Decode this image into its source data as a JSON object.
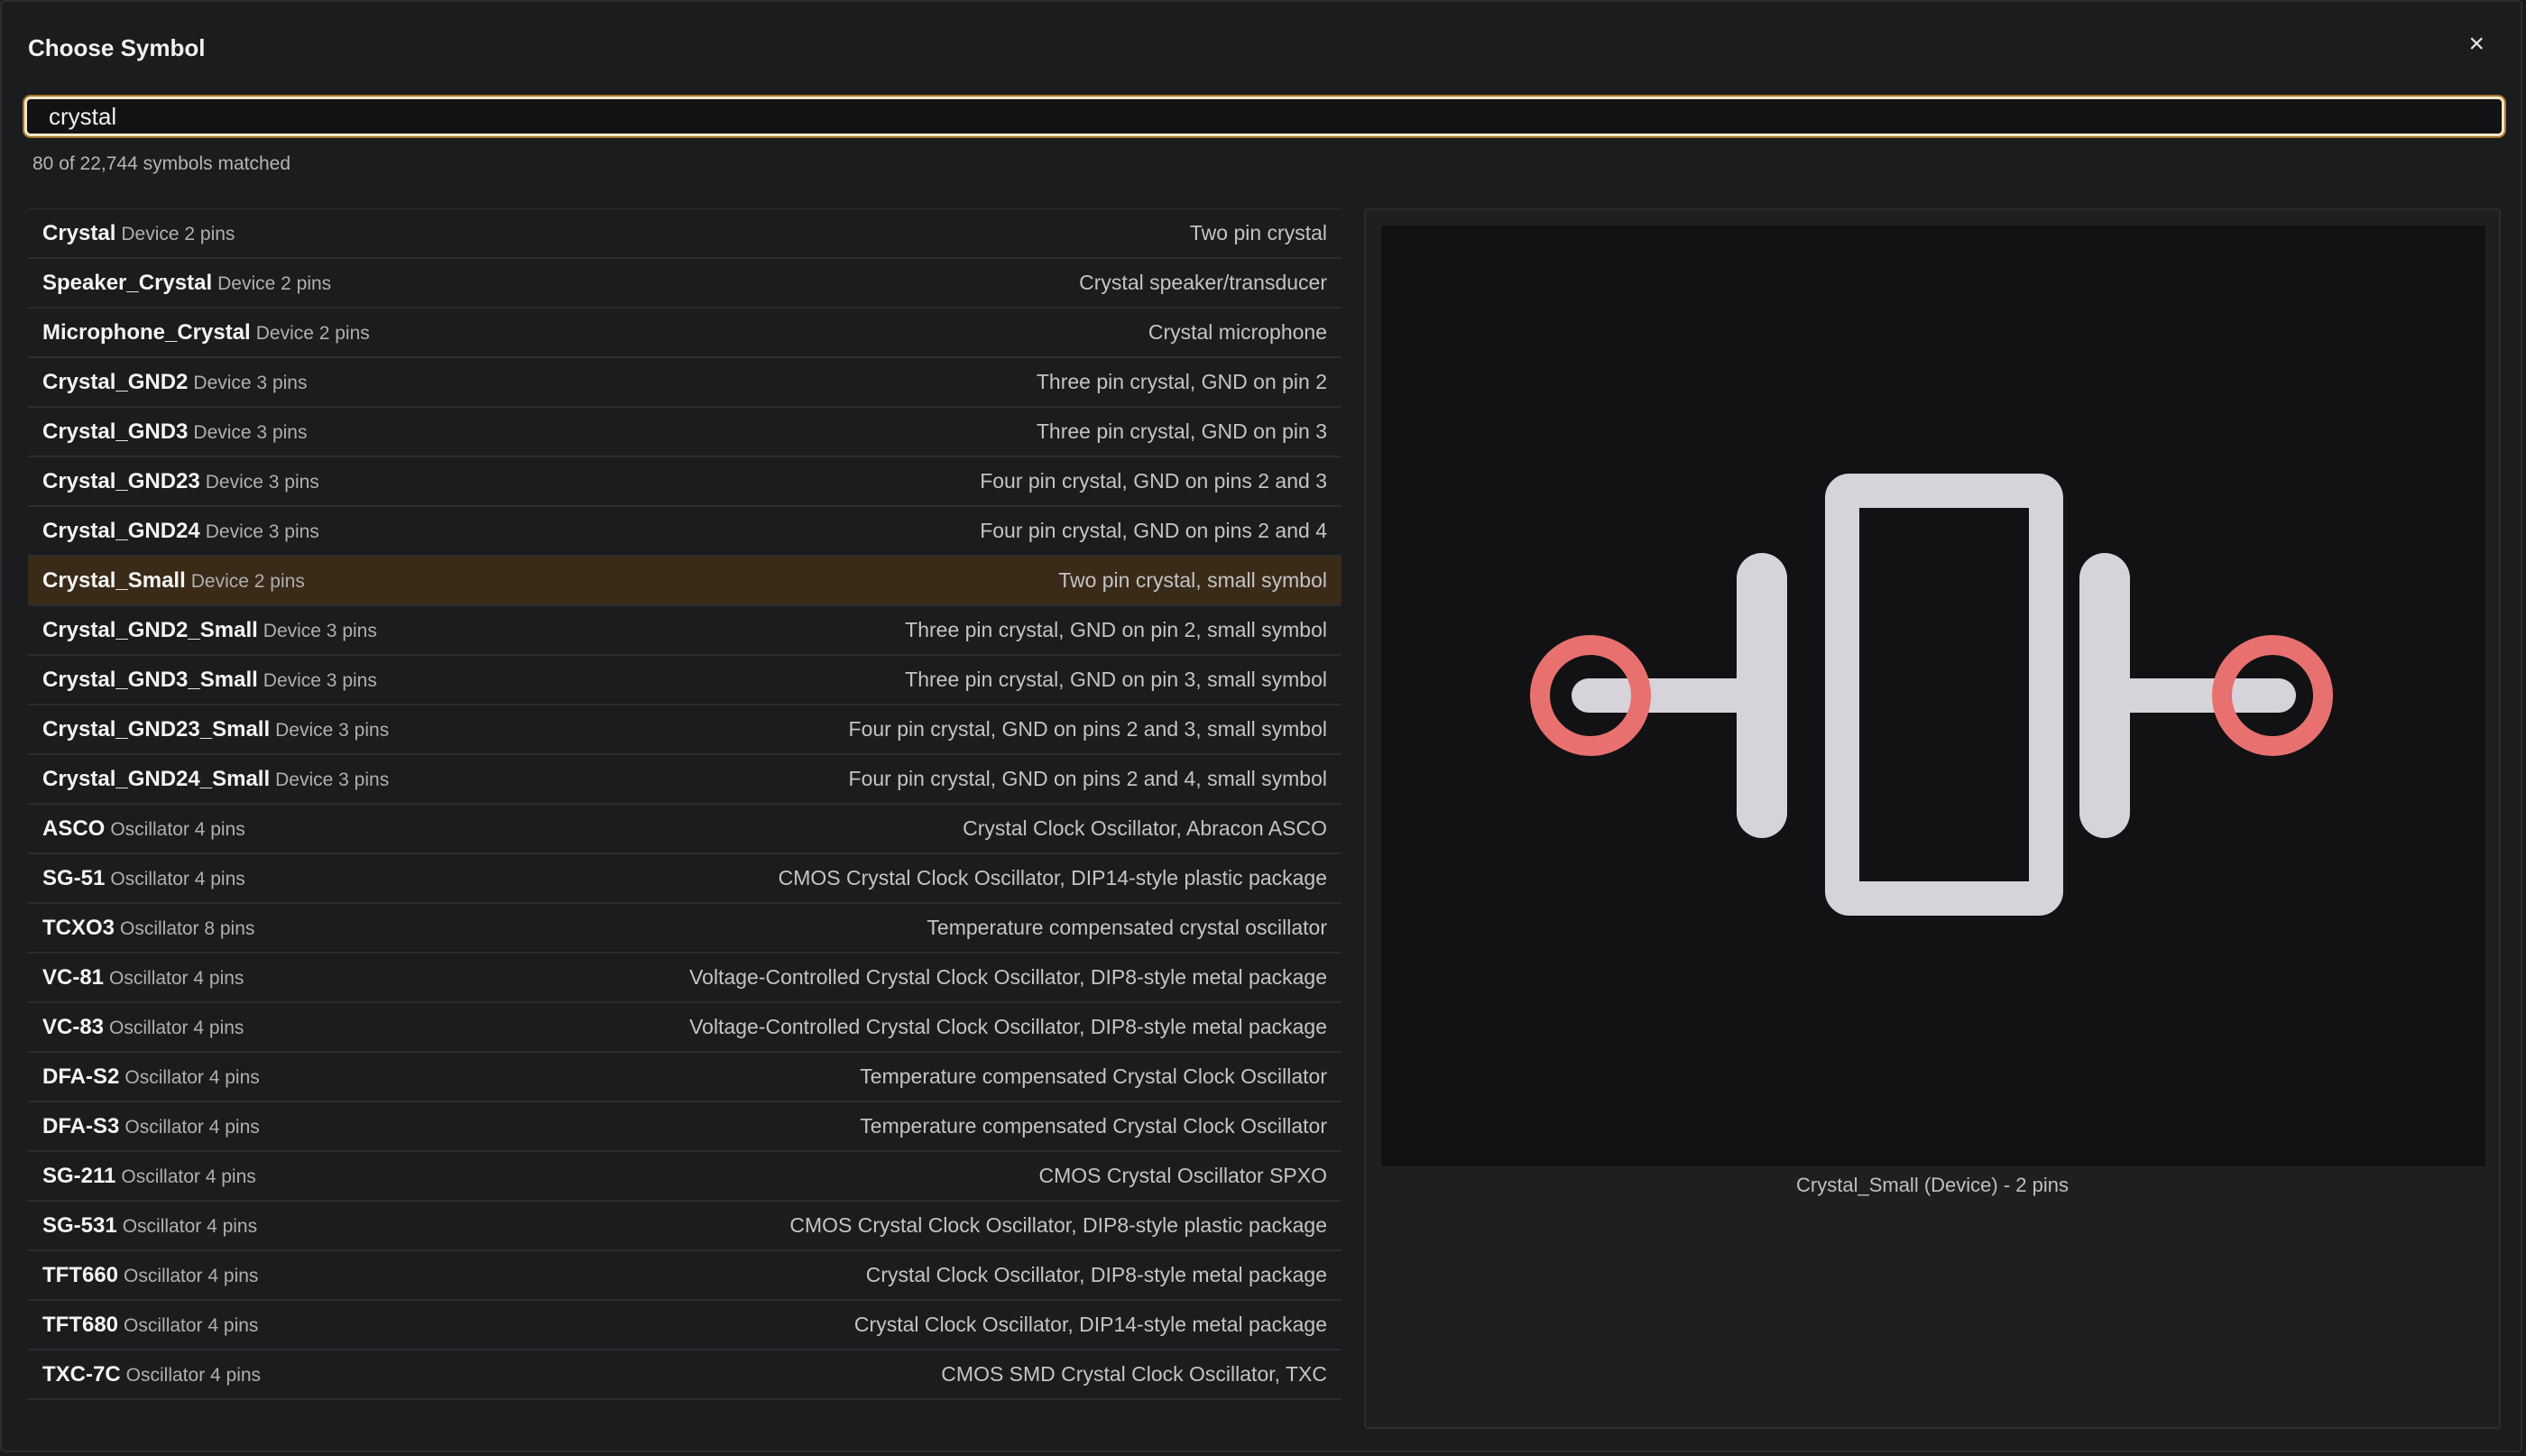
{
  "dialog": {
    "title": "Choose Symbol",
    "close_glyph": "×"
  },
  "search": {
    "value": "crystal"
  },
  "result_count": "80 of 22,744 symbols matched",
  "rows": [
    {
      "name": "Crystal",
      "meta": "Device 2 pins",
      "desc": "Two pin crystal"
    },
    {
      "name": "Speaker_Crystal",
      "meta": "Device 2 pins",
      "desc": "Crystal speaker/transducer"
    },
    {
      "name": "Microphone_Crystal",
      "meta": "Device 2 pins",
      "desc": "Crystal microphone"
    },
    {
      "name": "Crystal_GND2",
      "meta": "Device 3 pins",
      "desc": "Three pin crystal, GND on pin 2"
    },
    {
      "name": "Crystal_GND3",
      "meta": "Device 3 pins",
      "desc": "Three pin crystal, GND on pin 3"
    },
    {
      "name": "Crystal_GND23",
      "meta": "Device 3 pins",
      "desc": "Four pin crystal, GND on pins 2 and 3"
    },
    {
      "name": "Crystal_GND24",
      "meta": "Device 3 pins",
      "desc": "Four pin crystal, GND on pins 2 and 4"
    },
    {
      "name": "Crystal_Small",
      "meta": "Device 2 pins",
      "desc": "Two pin crystal, small symbol"
    },
    {
      "name": "Crystal_GND2_Small",
      "meta": "Device 3 pins",
      "desc": "Three pin crystal, GND on pin 2, small symbol"
    },
    {
      "name": "Crystal_GND3_Small",
      "meta": "Device 3 pins",
      "desc": "Three pin crystal, GND on pin 3, small symbol"
    },
    {
      "name": "Crystal_GND23_Small",
      "meta": "Device 3 pins",
      "desc": "Four pin crystal, GND on pins 2 and 3, small symbol"
    },
    {
      "name": "Crystal_GND24_Small",
      "meta": "Device 3 pins",
      "desc": "Four pin crystal, GND on pins 2 and 4, small symbol"
    },
    {
      "name": "ASCO",
      "meta": "Oscillator 4 pins",
      "desc": "Crystal Clock Oscillator, Abracon ASCO"
    },
    {
      "name": "SG-51",
      "meta": "Oscillator 4 pins",
      "desc": "CMOS Crystal Clock Oscillator, DIP14-style plastic package"
    },
    {
      "name": "TCXO3",
      "meta": "Oscillator 8 pins",
      "desc": "Temperature compensated crystal oscillator"
    },
    {
      "name": "VC-81",
      "meta": "Oscillator 4 pins",
      "desc": "Voltage-Controlled Crystal Clock Oscillator, DIP8-style metal package"
    },
    {
      "name": "VC-83",
      "meta": "Oscillator 4 pins",
      "desc": "Voltage-Controlled Crystal Clock Oscillator, DIP8-style metal package"
    },
    {
      "name": "DFA-S2",
      "meta": "Oscillator 4 pins",
      "desc": "Temperature compensated Crystal Clock Oscillator"
    },
    {
      "name": "DFA-S3",
      "meta": "Oscillator 4 pins",
      "desc": "Temperature compensated Crystal Clock Oscillator"
    },
    {
      "name": "SG-211",
      "meta": "Oscillator 4 pins",
      "desc": "CMOS Crystal Oscillator SPXO"
    },
    {
      "name": "SG-531",
      "meta": "Oscillator 4 pins",
      "desc": "CMOS Crystal Clock Oscillator, DIP8-style plastic package"
    },
    {
      "name": "TFT660",
      "meta": "Oscillator 4 pins",
      "desc": "Crystal Clock Oscillator, DIP8-style metal package"
    },
    {
      "name": "TFT680",
      "meta": "Oscillator 4 pins",
      "desc": "Crystal Clock Oscillator, DIP14-style metal package"
    },
    {
      "name": "TXC-7C",
      "meta": "Oscillator 4 pins",
      "desc": "CMOS SMD Crystal Clock Oscillator, TXC"
    }
  ],
  "selected_index": 7,
  "preview": {
    "caption": "Crystal_Small (Device) - 2 pins",
    "symbol_icon": "crystal-symbol-icon"
  },
  "colors": {
    "accent_border": "#f4e6c8",
    "selected_row": "#3a2a18",
    "symbol_body": "#d6d3da",
    "pin_marker": "#e8716f"
  }
}
